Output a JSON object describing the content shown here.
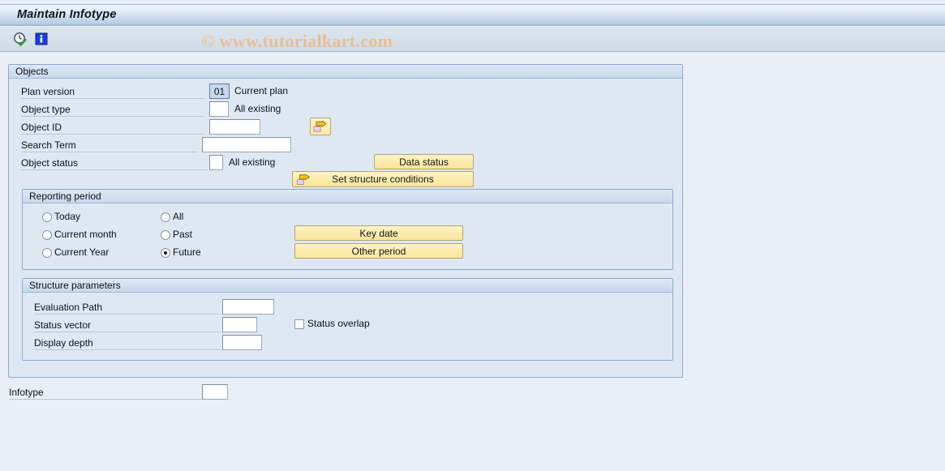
{
  "window": {
    "title": "Maintain Infotype"
  },
  "toolbar": {
    "icons": [
      {
        "name": "execute-clock-icon",
        "label": "Execute"
      },
      {
        "name": "info-icon",
        "label": "Information"
      }
    ]
  },
  "watermark": {
    "text": "© www.tutorialkart.com",
    "color": "#e9bd92"
  },
  "objects": {
    "title": "Objects",
    "plan_version": {
      "label": "Plan version",
      "value": "01",
      "description": "Current plan"
    },
    "object_type": {
      "label": "Object type",
      "value": "",
      "description": "All existing"
    },
    "object_id": {
      "label": "Object ID",
      "value": ""
    },
    "search_term": {
      "label": "Search Term",
      "value": ""
    },
    "object_status": {
      "label": "Object status",
      "value": "",
      "description": "All existing"
    },
    "multiple_selection_button": {
      "name": "arrow-right-icon",
      "label": ""
    },
    "data_status_button": "Data status",
    "set_structure_conditions_button": "Set structure conditions"
  },
  "reporting_period": {
    "title": "Reporting period",
    "options": [
      {
        "label": "Today",
        "selected": false
      },
      {
        "label": "Current month",
        "selected": false
      },
      {
        "label": "Current Year",
        "selected": false
      },
      {
        "label": "All",
        "selected": false
      },
      {
        "label": "Past",
        "selected": false
      },
      {
        "label": "Future",
        "selected": true
      }
    ],
    "key_date_button": "Key date",
    "other_period_button": "Other period"
  },
  "structure_parameters": {
    "title": "Structure parameters",
    "evaluation_path": {
      "label": "Evaluation Path",
      "value": ""
    },
    "status_vector": {
      "label": "Status vector",
      "value": ""
    },
    "display_depth": {
      "label": "Display depth",
      "value": ""
    },
    "status_overlap": {
      "label": "Status overlap",
      "checked": false
    }
  },
  "infotype": {
    "label": "Infotype",
    "value": ""
  },
  "colors": {
    "page_background": "#eaeff7",
    "group_background": "#dfe8f2",
    "button_yellow": "#fcecab",
    "titlebar_blue": "#b9cde4",
    "field_focus": "#c9d9ec"
  }
}
